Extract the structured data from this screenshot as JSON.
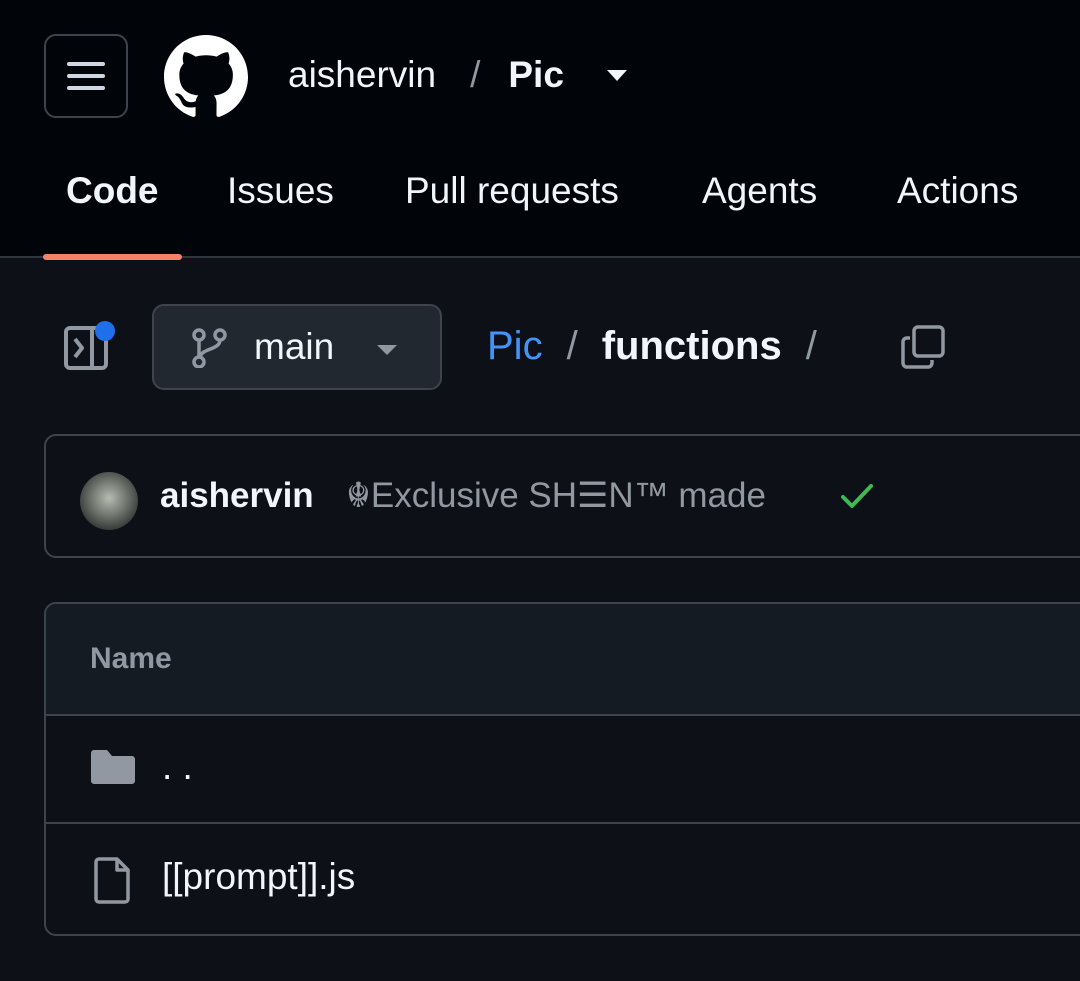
{
  "header": {
    "owner": "aishervin",
    "separator": "/",
    "repo": "Pic"
  },
  "tabs": [
    {
      "label": "Code",
      "active": true
    },
    {
      "label": "Issues",
      "active": false
    },
    {
      "label": "Pull requests",
      "active": false
    },
    {
      "label": "Agents",
      "active": false
    },
    {
      "label": "Actions",
      "active": false
    }
  ],
  "branch": {
    "name": "main"
  },
  "breadcrumb": {
    "root": "Pic",
    "sep": "/",
    "dir": "functions",
    "trailing_sep": "/"
  },
  "commit": {
    "author": "aishervin",
    "message": "☬Exclusive SH☰N™ made",
    "status": "success"
  },
  "files": {
    "column_header": "Name",
    "rows": [
      {
        "type": "folder",
        "name": ". ."
      },
      {
        "type": "file",
        "name": "[[prompt]].js"
      }
    ]
  },
  "colors": {
    "accent_underline": "#f78166",
    "link": "#4493f8",
    "success": "#3fb950",
    "notification_dot": "#1f6feb",
    "background": "#0d1117",
    "header_background": "#010409"
  },
  "icons": [
    "hamburger-menu-icon",
    "github-logo-icon",
    "chevron-down-icon",
    "side-panel-icon",
    "git-branch-icon",
    "copy-icon",
    "check-icon",
    "folder-icon",
    "file-icon"
  ]
}
